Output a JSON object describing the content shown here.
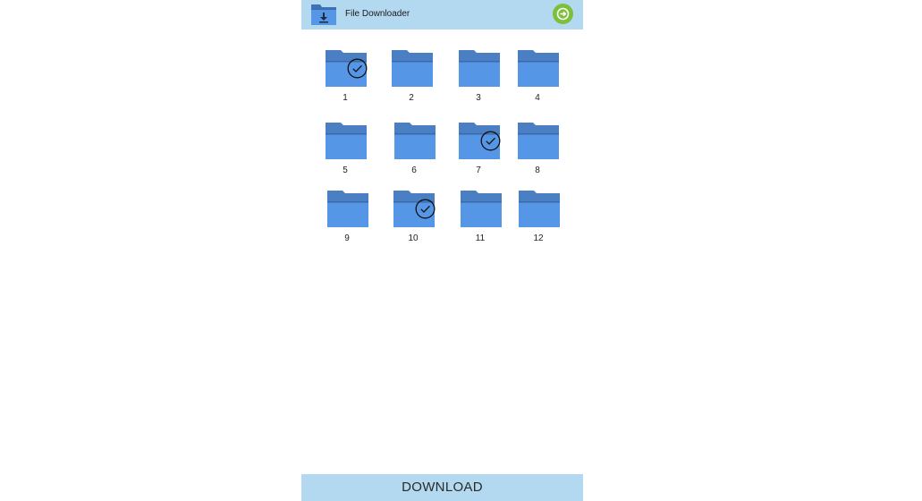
{
  "header": {
    "title": "File Downloader",
    "app_icon": "folder-download-icon",
    "exit_icon": "arrow-right-circle-icon",
    "background": "#b3d9f0",
    "exit_color": "#7cbf3a"
  },
  "folders": [
    {
      "label": "1",
      "selected": true
    },
    {
      "label": "2",
      "selected": false
    },
    {
      "label": "3",
      "selected": false
    },
    {
      "label": "4",
      "selected": false
    },
    {
      "label": "5",
      "selected": false
    },
    {
      "label": "6",
      "selected": false
    },
    {
      "label": "7",
      "selected": true
    },
    {
      "label": "8",
      "selected": false
    },
    {
      "label": "9",
      "selected": false
    },
    {
      "label": "10",
      "selected": true
    },
    {
      "label": "11",
      "selected": false
    },
    {
      "label": "12",
      "selected": false
    }
  ],
  "folder_colors": {
    "tab": "#4a7fc4",
    "body": "#5597e6",
    "edge": "#3a6aa8"
  },
  "download_button": {
    "label": "DOWNLOAD"
  }
}
